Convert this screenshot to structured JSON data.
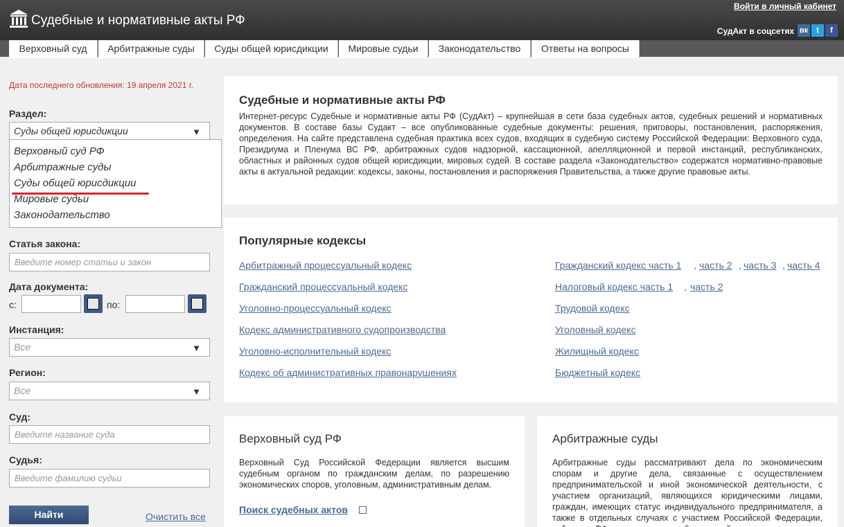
{
  "header": {
    "title": "Судебные и нормативные акты РФ",
    "login": "Войти в личный кабинет",
    "social_label": "СудАкт в соцсетях",
    "social": [
      "вк",
      "t",
      "f"
    ]
  },
  "nav": {
    "tabs": [
      "Верховный суд",
      "Арбитражные суды",
      "Суды общей юрисдикции",
      "Мировые судьи",
      "Законодательство",
      "Ответы на вопросы"
    ]
  },
  "sidebar": {
    "updated": "Дата последнего обновления: 19 апреля 2021 г.",
    "section_label": "Раздел:",
    "section_value": "Суды общей юрисдикции",
    "dropdown": [
      "Верховный суд РФ",
      "Арбитражные суды",
      "Суды общей юрисдикции",
      "Мировые судьи",
      "Законодательство"
    ],
    "law_label": "Статья закона:",
    "law_placeholder": "Введите номер статьи и закон",
    "date_label": "Дата документа:",
    "date_from": "с:",
    "date_to": "по:",
    "instance_label": "Инстанция:",
    "instance_value": "Все",
    "region_label": "Регион:",
    "region_value": "Все",
    "court_label": "Суд:",
    "court_placeholder": "Введите название суда",
    "judge_label": "Судья:",
    "judge_placeholder": "Введите фамилию судьи",
    "search_button": "Найти",
    "clear": "Очистить все"
  },
  "intro": {
    "title": "Судебные и нормативные акты РФ",
    "text": "Интернет-ресурс Судебные и нормативные акты РФ (СудАкт) – крупнейшая в сети база судебных актов, судебных решений и нормативных документов. В составе базы Судакт – все опубликованные судебные документы: решения, приговоры, постановления, распоряжения, определения. На сайте представлена судебная практика всех судов, входящих в судебную систему Российской Федерации: Верховного суда, Президиума и Пленума ВС РФ, арбитражных судов надзорной, кассационной, апелляционной и первой инстанций, республиканских, областных и районных судов общей юрисдикции, мировых судей. В составе раздела «Законодательство» содержатся нормативно-правовые акты в актуальной редакции: кодексы, законы, постановления и распоряжения Правительства, а также другие правовые акты."
  },
  "codes": {
    "title": "Популярные кодексы",
    "left": [
      "Арбитражный процессуальный кодекс",
      "Гражданский процессуальный кодекс",
      "Уголовно-процессуальный кодекс",
      "Кодекс административного судопроизводства",
      "Уголовно-исполнительный кодекс",
      "Кодекс об административных правонарушениях"
    ],
    "civil": [
      "Гражданский кодекс часть 1",
      "часть 2",
      "часть 3",
      "часть 4"
    ],
    "tax": [
      "Налоговый кодекс часть 1",
      "часть 2"
    ],
    "right": [
      "Трудовой кодекс",
      "Уголовный кодекс",
      "Жилищный кодекс",
      "Бюджетный кодекс"
    ],
    "sep": ","
  },
  "vs": {
    "title": "Верховный суд РФ",
    "text": "Верховный Суд Российской Федерации является высшим судебным органом по гражданским делам, по разрешению экономических споров, уголовным, административным делам.",
    "search": "Поиск судебных актов"
  },
  "as": {
    "title": "Арбитражные суды",
    "text": "Арбитражные суды рассматривают дела по экономическим спорам и другие дела, связанные с осуществлением предпринимательской и иной экономической деятельности, с участием организаций, являющихся юридическими лицами, граждан, имеющих статус индивидуального предпринимателя, а также в отдельных случаях с участием Российской Федерации, субъектов РФ, муниципальных образований."
  },
  "colors": {
    "accent": "#4a6a94",
    "header": "#3a3a3a",
    "underline": "#e0212a",
    "date": "#c0392b"
  }
}
